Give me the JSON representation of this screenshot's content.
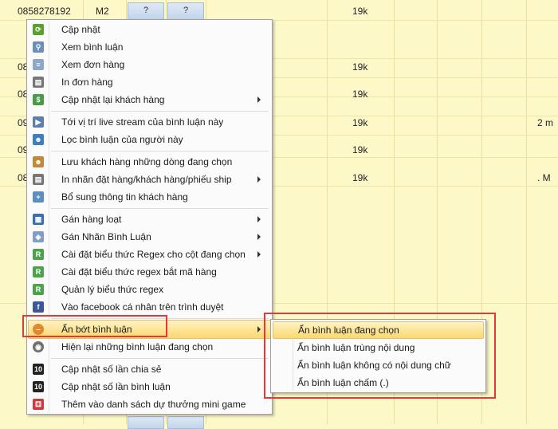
{
  "grid": {
    "first_row": {
      "phone": "0858278192",
      "code": "M2",
      "q1": "?",
      "q2": "?",
      "price": "19k"
    },
    "row_prefixes": [
      "08",
      "08",
      "09",
      "09",
      "08"
    ],
    "prices": [
      "19k",
      "19k",
      "19k",
      "19k",
      "19k"
    ],
    "right_texts": {
      "row4": "2 m",
      "row7": ". M"
    }
  },
  "context_menu": {
    "items": [
      {
        "label": "Cập nhật",
        "icon": "refresh-icon",
        "submenu": false
      },
      {
        "label": "Xem bình luận",
        "icon": "magnifier-icon",
        "submenu": false
      },
      {
        "label": "Xem đơn hàng",
        "icon": "document-icon",
        "submenu": false
      },
      {
        "label": "In đơn hàng",
        "icon": "printer-icon",
        "submenu": false
      },
      {
        "label": "Cập nhật lại khách hàng",
        "icon": "customer-update-icon",
        "submenu": true
      },
      {
        "label": "Tới vị trí live stream của bình luận này",
        "icon": "stream-position-icon",
        "submenu": false
      },
      {
        "label": "Lọc bình luận của người này",
        "icon": "filter-user-icon",
        "submenu": false
      },
      {
        "label": "Lưu khách hàng những dòng đang chọn",
        "icon": "save-customer-icon",
        "submenu": false
      },
      {
        "label": "In nhãn đặt hàng/khách hàng/phiếu ship",
        "icon": "print-label-icon",
        "submenu": true
      },
      {
        "label": "Bổ sung thông tin khách hàng",
        "icon": "add-info-icon",
        "submenu": false
      },
      {
        "label": "Gán hàng loạt",
        "icon": "batch-assign-icon",
        "submenu": true
      },
      {
        "label": "Gán Nhãn Bình Luận",
        "icon": "tag-icon",
        "submenu": true
      },
      {
        "label": "Cài đặt biểu thức Regex cho cột đang chọn",
        "icon": "regex-icon",
        "submenu": true
      },
      {
        "label": "Cài đặt biểu thức regex bắt mã hàng",
        "icon": "regex-icon",
        "submenu": false
      },
      {
        "label": "Quản lý biểu thức regex",
        "icon": "regex-icon",
        "submenu": false
      },
      {
        "label": "Vào facebook cá nhân trên trình duyệt",
        "icon": "facebook-icon",
        "submenu": false
      },
      {
        "label": "Ẩn bớt bình luận",
        "icon": "hide-icon",
        "submenu": true
      },
      {
        "label": "Hiện lại những bình luận đang chọn",
        "icon": "eye-icon",
        "submenu": false
      },
      {
        "label": "Cập nhật số lần chia sẻ",
        "icon": "counter-icon",
        "submenu": false
      },
      {
        "label": "Cập nhật số lần bình luận",
        "icon": "counter-icon",
        "submenu": false
      },
      {
        "label": "Thêm vào danh sách dự thưởng mini game",
        "icon": "dice-icon",
        "submenu": false
      }
    ]
  },
  "submenu": {
    "items": [
      {
        "label": "Ẩn bình luận đang chọn"
      },
      {
        "label": "Ẩn bình luận trùng nội dung"
      },
      {
        "label": "Ẩn bình luận không có nội dung chữ"
      },
      {
        "label": "Ẩn bình luận chấm (.)"
      }
    ]
  },
  "colors": {
    "highlight": "#fbd870",
    "annotation_box": "#e03a3a",
    "grid_background": "#fdf8c8"
  }
}
